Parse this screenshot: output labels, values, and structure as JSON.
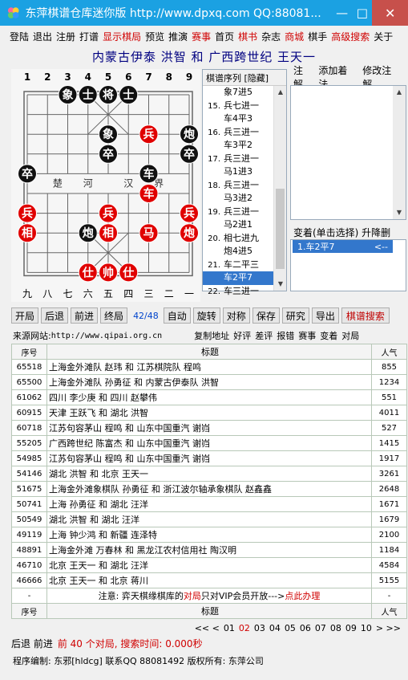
{
  "titlebar": {
    "title": "东萍棋谱仓库迷你版 http://www.dpxq.com QQ:88081...",
    "colors": {
      "bg": "#1ba1e2",
      "close": "#c7504b"
    }
  },
  "menu": [
    {
      "label": "登陆",
      "red": false
    },
    {
      "label": "退出",
      "red": false
    },
    {
      "label": "注册",
      "red": false
    },
    {
      "label": "打谱",
      "red": false
    },
    {
      "label": "显示棋局",
      "red": true
    },
    {
      "label": "预览",
      "red": false
    },
    {
      "label": "推演",
      "red": false
    },
    {
      "label": "赛事",
      "red": true
    },
    {
      "label": "首页",
      "red": false
    },
    {
      "label": "棋书",
      "red": true
    },
    {
      "label": "杂志",
      "red": false
    },
    {
      "label": "商城",
      "red": true
    },
    {
      "label": "棋手",
      "red": false
    },
    {
      "label": "高级搜索",
      "red": true
    },
    {
      "label": "关于",
      "red": false
    }
  ],
  "game_title": "内蒙古伊泰 洪智 和 广西跨世纪 王天一",
  "board": {
    "top_files": [
      "1",
      "2",
      "3",
      "4",
      "5",
      "6",
      "7",
      "8",
      "9"
    ],
    "bottom_files": [
      "九",
      "八",
      "七",
      "六",
      "五",
      "四",
      "三",
      "二",
      "一"
    ],
    "river": [
      "楚",
      "河",
      "汉",
      "界"
    ],
    "pieces": [
      {
        "ch": "象",
        "side": "black",
        "col": 2,
        "row": 0
      },
      {
        "ch": "士",
        "side": "black",
        "col": 3,
        "row": 0
      },
      {
        "ch": "将",
        "side": "black",
        "col": 4,
        "row": 0
      },
      {
        "ch": "士",
        "side": "black",
        "col": 5,
        "row": 0
      },
      {
        "ch": "象",
        "side": "black",
        "col": 4,
        "row": 2
      },
      {
        "ch": "兵",
        "side": "red",
        "col": 6,
        "row": 2
      },
      {
        "ch": "炮",
        "side": "black",
        "col": 8,
        "row": 2
      },
      {
        "ch": "卒",
        "side": "black",
        "col": 4,
        "row": 3
      },
      {
        "ch": "卒",
        "side": "black",
        "col": 8,
        "row": 3
      },
      {
        "ch": "卒",
        "side": "black",
        "col": 0,
        "row": 4
      },
      {
        "ch": "车",
        "side": "black",
        "col": 6,
        "row": 4
      },
      {
        "ch": "车",
        "side": "red",
        "col": 6,
        "row": 5
      },
      {
        "ch": "兵",
        "side": "red",
        "col": 0,
        "row": 6
      },
      {
        "ch": "兵",
        "side": "red",
        "col": 4,
        "row": 6
      },
      {
        "ch": "兵",
        "side": "red",
        "col": 8,
        "row": 6
      },
      {
        "ch": "相",
        "side": "red",
        "col": 0,
        "row": 7
      },
      {
        "ch": "炮",
        "side": "black",
        "col": 3,
        "row": 7
      },
      {
        "ch": "相",
        "side": "red",
        "col": 4,
        "row": 7
      },
      {
        "ch": "马",
        "side": "red",
        "col": 6,
        "row": 7
      },
      {
        "ch": "炮",
        "side": "red",
        "col": 8,
        "row": 7
      },
      {
        "ch": "仕",
        "side": "red",
        "col": 3,
        "row": 9
      },
      {
        "ch": "帅",
        "side": "red",
        "col": 4,
        "row": 9
      },
      {
        "ch": "仕",
        "side": "red",
        "col": 5,
        "row": 9
      }
    ],
    "colors": {
      "red": "#e00000",
      "black": "#111111",
      "grid": "#666666"
    }
  },
  "movelist": {
    "header": "棋谱序列  [隐藏]",
    "rows": [
      {
        "no": "",
        "text": "象7进5",
        "sel": false
      },
      {
        "no": "15.",
        "text": "兵七进一",
        "sel": false
      },
      {
        "no": "",
        "text": "车4平3",
        "sel": false
      },
      {
        "no": "16.",
        "text": "兵三进一",
        "sel": false
      },
      {
        "no": "",
        "text": "车3平2",
        "sel": false
      },
      {
        "no": "17.",
        "text": "兵三进一",
        "sel": false
      },
      {
        "no": "",
        "text": "马1进3",
        "sel": false
      },
      {
        "no": "18.",
        "text": "兵三进一",
        "sel": false
      },
      {
        "no": "",
        "text": "马3进2",
        "sel": false
      },
      {
        "no": "19.",
        "text": "兵三进一",
        "sel": false
      },
      {
        "no": "",
        "text": "马2进1",
        "sel": false
      },
      {
        "no": "20.",
        "text": "相七进九",
        "sel": false
      },
      {
        "no": "",
        "text": "炮4进5",
        "sel": false
      },
      {
        "no": "21.",
        "text": "车二平三",
        "sel": false
      },
      {
        "no": "",
        "text": "车2平7",
        "sel": true
      },
      {
        "no": "22.",
        "text": "车三进一",
        "sel": false
      }
    ]
  },
  "notes": {
    "labels": [
      "注解",
      "添加着法",
      "修改注解"
    ]
  },
  "variation": {
    "header": "变着(单击选择)  升降删",
    "item": "1.车2平7",
    "arrow": "<--"
  },
  "toolbar": {
    "buttons_left": [
      "开局",
      "后退",
      "前进",
      "终局"
    ],
    "counter": "42/48",
    "buttons_right": [
      "自动",
      "旋转",
      "对称",
      "保存",
      "研究",
      "导出"
    ],
    "search": "棋谱搜索"
  },
  "source": {
    "label": "来源网站:",
    "url": "http://www.qipai.org.cn",
    "links": [
      "复制地址",
      "好评",
      "差评",
      "报错",
      "赛事",
      "变着",
      "对局"
    ]
  },
  "table": {
    "headers": [
      "序号",
      "标题",
      "人气"
    ],
    "rows": [
      [
        "65518",
        "上海金外滩队 赵玮 和 江苏棋院队 程鸣",
        "855"
      ],
      [
        "65500",
        "上海金外滩队 孙勇征 和 内蒙古伊泰队 洪智",
        "1234"
      ],
      [
        "61062",
        "四川 李少庚 和 四川 赵攀伟",
        "551"
      ],
      [
        "60915",
        "天津 王跃飞 和 湖北 洪智",
        "4011"
      ],
      [
        "60718",
        "江苏句容茅山 程鸣 和 山东中国重汽 谢岿",
        "527"
      ],
      [
        "55205",
        "广西跨世纪 陈富杰 和 山东中国重汽 谢岿",
        "1415"
      ],
      [
        "54985",
        "江苏句容茅山 程鸣 和 山东中国重汽 谢岿",
        "1917"
      ],
      [
        "54146",
        "湖北 洪智 和 北京 王天一",
        "3261"
      ],
      [
        "51675",
        "上海金外滩象棋队 孙勇征 和 浙江波尔轴承象棋队 赵鑫鑫",
        "2648"
      ],
      [
        "50741",
        "上海 孙勇征 和 湖北 汪洋",
        "1671"
      ],
      [
        "50549",
        "湖北 洪智 和 湖北 汪洋",
        "1679"
      ],
      [
        "49119",
        "上海 钟少鸿 和 新疆 连泽特",
        "2100"
      ],
      [
        "48891",
        "上海金外滩 万春林 和 黑龙江农村信用社 陶汉明",
        "1184"
      ],
      [
        "46710",
        "北京 王天一 和 湖北 汪洋",
        "4584"
      ],
      [
        "46666",
        "北京 王天一 和 北京 蒋川",
        "5155"
      ]
    ],
    "notice": {
      "dash": "-",
      "pre": "注意: 弈天棋缘棋库的",
      "red1": "对局",
      "mid": "只对VIP会员开放--->",
      "red2": "点此办理"
    },
    "footer_headers": [
      "序号",
      "标题",
      "人气"
    ]
  },
  "pager": {
    "prefix": "<< <",
    "pages": [
      "01",
      "02",
      "03",
      "04",
      "05",
      "06",
      "07",
      "08",
      "09",
      "10"
    ],
    "current": "02",
    "suffix": "> >>"
  },
  "status": {
    "nav": "后退 前进",
    "info": "前 40 个对局, 搜索时间: 0.000秒"
  },
  "footer": {
    "text": "程序编制: 东邪[hldcg] 联系QQ 88081492 版权所有: 东萍公司"
  }
}
